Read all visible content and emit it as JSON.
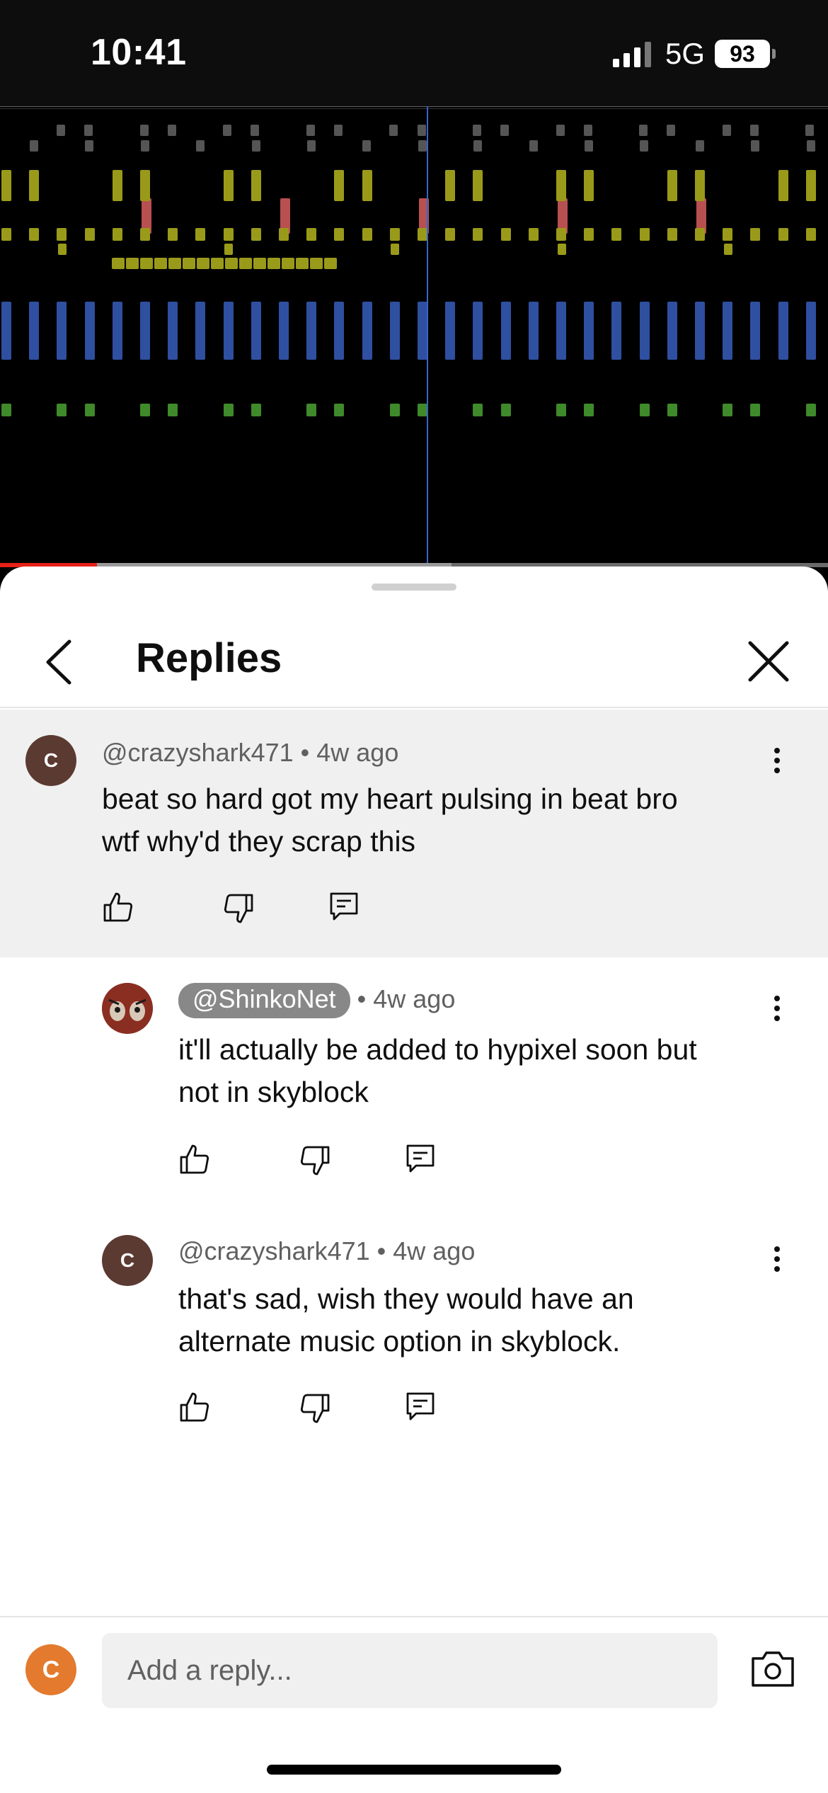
{
  "status_bar": {
    "time": "10:41",
    "network": "5G",
    "battery": "93"
  },
  "video": {
    "progress_played_fraction": 0.117,
    "progress_buffered_fraction": 0.545
  },
  "sheet": {
    "title": "Replies"
  },
  "comments": [
    {
      "avatar_letter": "C",
      "avatar_color": "#5b3a32",
      "handle": "@crazyshark471",
      "time": "4w ago",
      "text_line1": "beat so hard got my heart pulsing in beat bro",
      "text_line2": "wtf why'd they scrap this",
      "highlighted": true
    },
    {
      "avatar_letter": "",
      "avatar_color": "#8a2e22",
      "handle": "@ShinkoNet",
      "time": "4w ago",
      "text_line1": "it'll actually be added to hypixel soon but",
      "text_line2": "not in skyblock",
      "creator": true
    },
    {
      "avatar_letter": "C",
      "avatar_color": "#5b3a32",
      "handle": "@crazyshark471",
      "time": "4w ago",
      "text_line1": "that's sad, wish they would have an",
      "text_line2": "alternate music option in skyblock."
    }
  ],
  "composer": {
    "avatar_letter": "C",
    "avatar_color": "#e37a2e",
    "placeholder": "Add a reply..."
  },
  "icons": {
    "back": "chevron-left-icon",
    "close": "close-icon",
    "more": "more-vert-icon",
    "like": "thumb-up-icon",
    "dislike": "thumb-down-icon",
    "reply": "comment-icon",
    "camera": "camera-icon"
  },
  "colors": {
    "note_yellow": "#9a9a1a",
    "note_red": "#b85050",
    "note_blue": "#2f4fa0",
    "note_green": "#3f8a2a",
    "note_gray": "#555555",
    "progress_red": "#e62117"
  }
}
